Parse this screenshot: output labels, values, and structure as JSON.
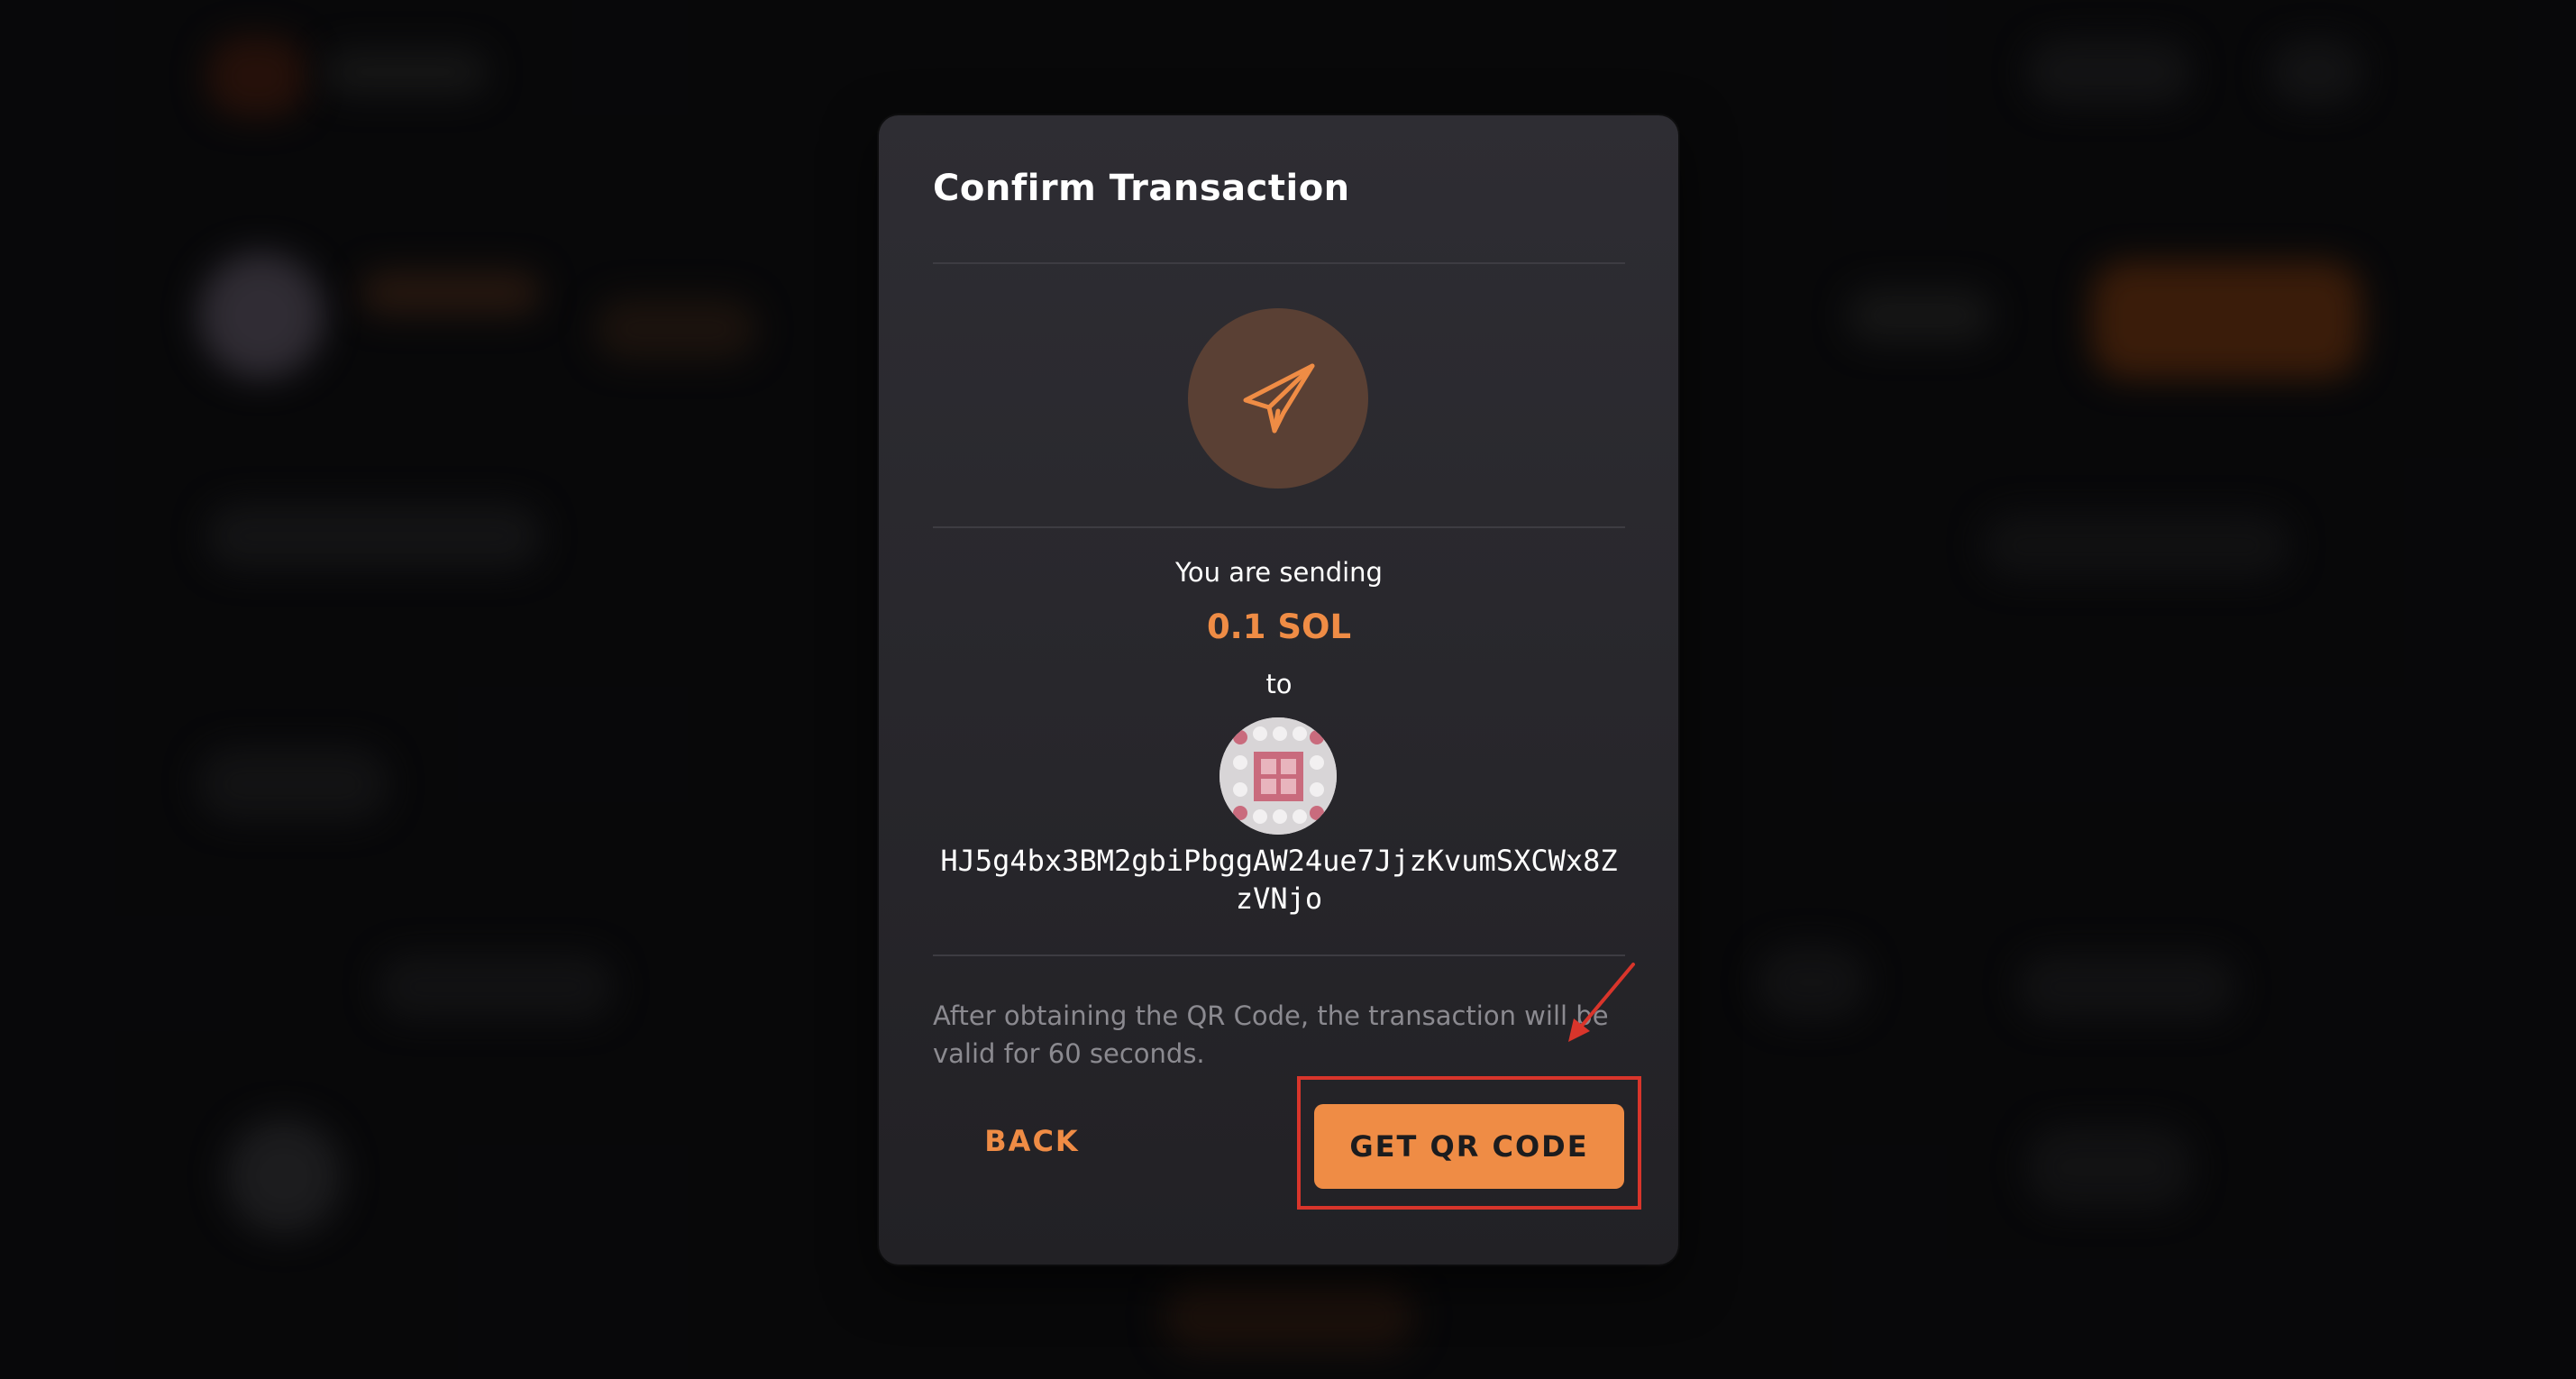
{
  "modal": {
    "title": "Confirm Transaction",
    "sending_label": "You are sending",
    "amount": "0.1 SOL",
    "to_label": "to",
    "recipient_address": "HJ5g4bx3BM2gbiPbggAW24ue7JjzKvumSXCWx8ZzVNjo",
    "note": "After obtaining the QR Code, the transaction will be valid for 60 seconds.",
    "back_label": "BACK",
    "qr_button_label": "GET QR CODE",
    "icon": "paper-plane-icon"
  },
  "colors": {
    "accent": "#ef8c45",
    "highlight": "#d9352b",
    "modal_bg": "#2a292e"
  }
}
